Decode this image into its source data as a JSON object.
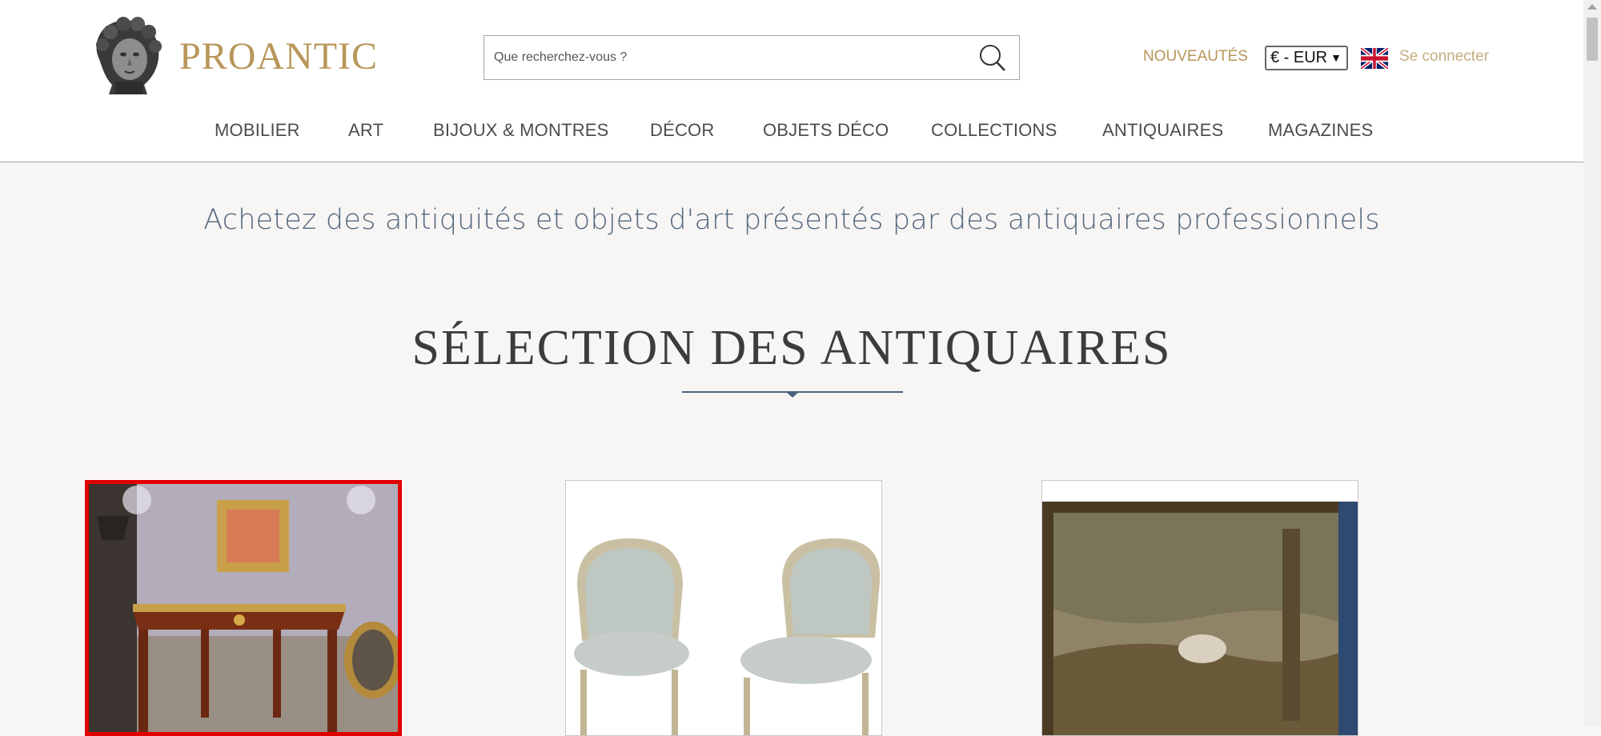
{
  "brand": {
    "name": "PROANTIC"
  },
  "search": {
    "placeholder": "Que recherchez-vous ?"
  },
  "header": {
    "new_link": "NOUVEAUTÉS",
    "currency": "€ - EUR",
    "language_flag": "uk-flag-icon",
    "login": "Se connecter"
  },
  "nav": [
    {
      "label": "MOBILIER"
    },
    {
      "label": "ART"
    },
    {
      "label": "BIJOUX & MONTRES"
    },
    {
      "label": "DÉCOR"
    },
    {
      "label": "OBJETS DÉCO"
    },
    {
      "label": "COLLECTIONS"
    },
    {
      "label": "ANTIQUAIRES"
    },
    {
      "label": "MAGAZINES"
    }
  ],
  "tagline": "Achetez des antiquités et objets d'art présentés par des antiquaires professionnels",
  "section": {
    "title": "SÉLECTION DES ANTIQUAIRES"
  },
  "products": [
    {
      "image": "louis-xv-bureau-plat-photo",
      "highlighted": true
    },
    {
      "image": "pair-of-bergere-chairs-photo",
      "highlighted": false
    },
    {
      "image": "aubusson-tapestry-photo",
      "highlighted": false
    }
  ],
  "colors": {
    "gold": "#b89658",
    "tagline": "#54677f",
    "highlight": "#e00000"
  }
}
